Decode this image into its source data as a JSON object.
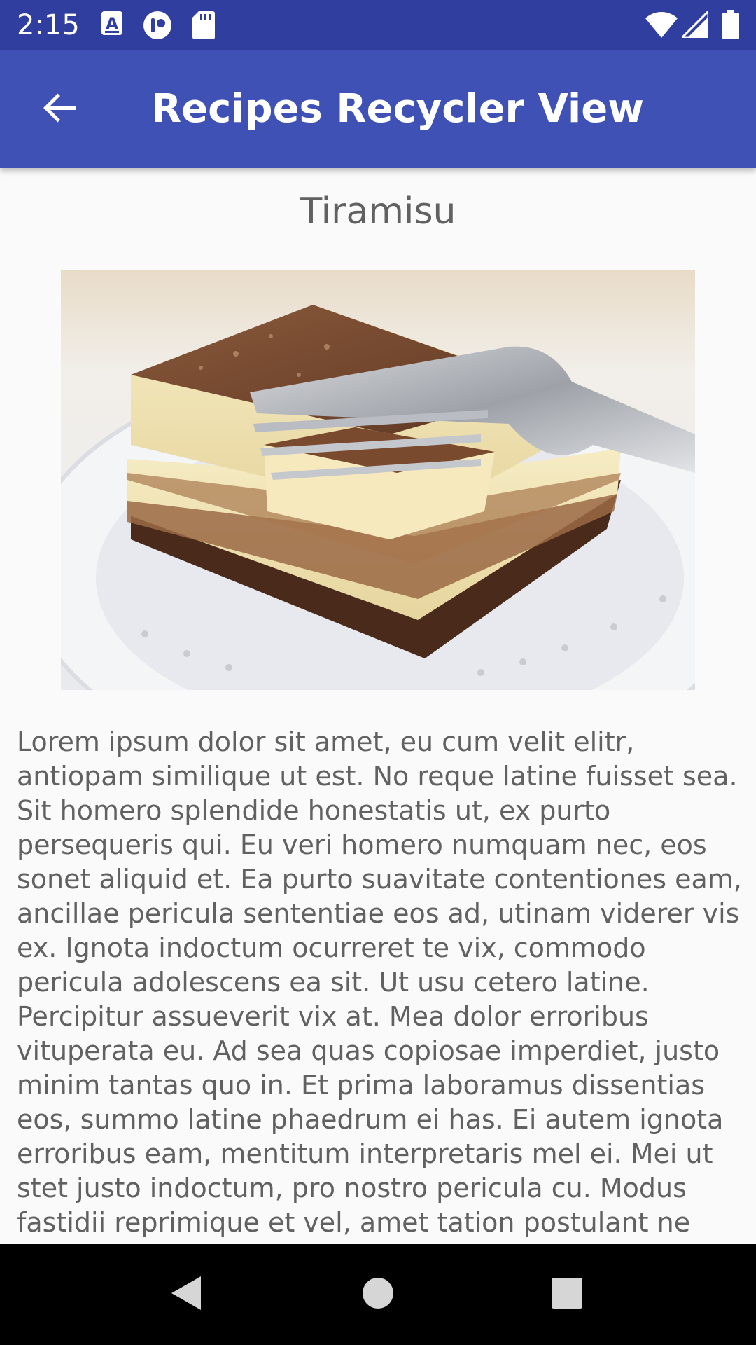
{
  "status_bar": {
    "time": "2:15",
    "notification_icons": [
      "a-box-icon",
      "circle-app-icon",
      "sd-card-icon"
    ],
    "system_icons": [
      "wifi-icon",
      "cell-signal-icon",
      "battery-icon"
    ]
  },
  "app_bar": {
    "title": "Recipes Recycler View",
    "back_icon": "arrow-back-icon",
    "color": "#3f51b5",
    "status_color": "#303f9f"
  },
  "recipe": {
    "title": "Tiramisu",
    "image_subject": "tiramisu slice with fork",
    "description": "Lorem ipsum dolor sit amet, eu cum velit elitr, antiopam similique ut est. No reque latine fuisset sea. Sit homero splendide honestatis ut, ex purto persequeris qui. Eu veri homero numquam nec, eos sonet aliquid et. Ea purto suavitate contentiones eam, ancillae pericula sententiae eos ad, utinam viderer vis ex. Ignota indoctum ocurreret te vix, commodo pericula adolescens ea sit. Ut usu cetero latine. Percipitur assueverit vix at. Mea dolor erroribus vituperata eu. Ad sea quas copiosae imperdiet, justo minim tantas quo in. Et prima laboramus dissentias eos, summo latine phaedrum ei has. Ei autem ignota erroribus eam, mentitum interpretaris mel ei. Mei ut stet justo indoctum, pro nostro pericula cu. Modus fastidii reprimique et vel, amet tation postulant ne quo, at"
  },
  "nav_bar": {
    "buttons": [
      "back-triangle-icon",
      "home-circle-icon",
      "recents-square-icon"
    ]
  }
}
